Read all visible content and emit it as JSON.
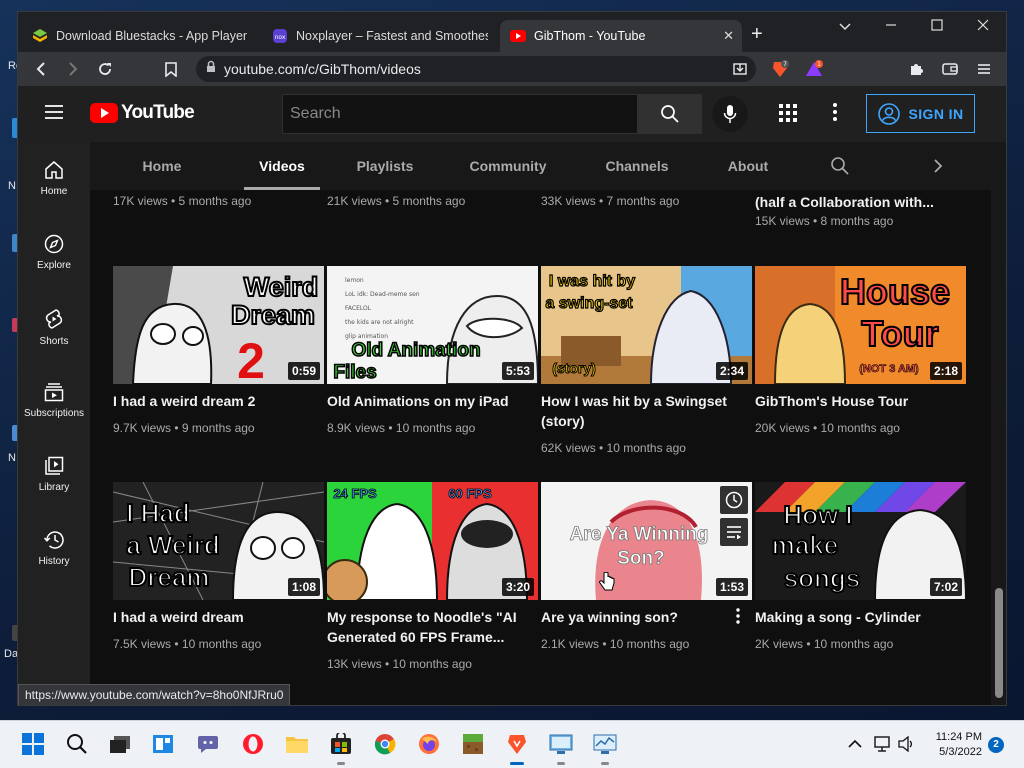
{
  "desktop": {
    "fragments": [
      "Re",
      "N",
      "N",
      "Da"
    ]
  },
  "browser": {
    "tabs": [
      {
        "title": "Download Bluestacks - App Player on",
        "favicon": "bluestacks-icon"
      },
      {
        "title": "Noxplayer – Fastest and Smoothest Ar",
        "favicon": "noxplayer-icon"
      },
      {
        "title": "GibThom - YouTube",
        "favicon": "youtube-icon",
        "active": true
      }
    ],
    "url": "youtube.com/c/GibThom/videos",
    "extension_badges": {
      "brave_shields": "7",
      "brave_rewards": "1"
    },
    "status_url": "https://www.youtube.com/watch?v=8ho0NfJRru0"
  },
  "youtube": {
    "logo_text": "YouTube",
    "search_placeholder": "Search",
    "sign_in_label": "SIGN IN",
    "guide": [
      {
        "label": "Home",
        "icon": "home-icon"
      },
      {
        "label": "Explore",
        "icon": "compass-icon"
      },
      {
        "label": "Shorts",
        "icon": "shorts-icon"
      },
      {
        "label": "Subscriptions",
        "icon": "subscriptions-icon"
      },
      {
        "label": "Library",
        "icon": "library-icon"
      },
      {
        "label": "History",
        "icon": "history-icon"
      }
    ],
    "channel_tabs": [
      "Home",
      "Videos",
      "Playlists",
      "Community",
      "Channels",
      "About"
    ],
    "active_tab": "Videos",
    "top_row_meta": [
      "17K views • 5 months ago",
      "21K views • 5 months ago",
      "33K views • 7 months ago",
      "15K views • 8 months ago"
    ],
    "top_row_partial_title": "(half a Collaboration with...",
    "videos": [
      {
        "title": "I had a weird dream 2",
        "meta": "9.7K views • 9 months ago",
        "duration": "0:59",
        "thumb_text": [
          "Weird",
          "Dream"
        ]
      },
      {
        "title": "Old Animations on my iPad",
        "meta": "8.9K views • 10 months ago",
        "duration": "5:53",
        "thumb_text": [
          "Old Animation",
          "Files"
        ]
      },
      {
        "title": "How I was hit by a Swingset (story)",
        "title_lines": [
          "How I was hit by a Swingset",
          "(story)"
        ],
        "meta": "62K views • 10 months ago",
        "duration": "2:34",
        "thumb_text": [
          "I was hit by",
          "a swing-set",
          "(story)"
        ]
      },
      {
        "title": "GibThom's House Tour",
        "meta": "20K views • 10 months ago",
        "duration": "2:18",
        "thumb_text": [
          "House",
          "Tour",
          "(NOT 3 AM)"
        ]
      },
      {
        "title": "I had a weird dream",
        "meta": "7.5K views • 10 months ago",
        "duration": "1:08",
        "thumb_text": [
          "I Had",
          "a Weird",
          "Dream"
        ]
      },
      {
        "title_lines": [
          "My response to Noodle's \"AI",
          "Generated 60 FPS Frame..."
        ],
        "meta": "13K views • 10 months ago",
        "duration": "3:20",
        "thumb_text": [
          "24 FPS",
          "60 FPS"
        ]
      },
      {
        "title": "Are ya winning son?",
        "meta": "2.1K views • 10 months ago",
        "duration": "1:53",
        "thumb_text": [
          "Are Ya Winning",
          "Son?"
        ]
      },
      {
        "title": "Making a song - Cylinder",
        "meta": "2K views • 10 months ago",
        "duration": "7:02",
        "thumb_text": [
          "How I",
          "make",
          "songs"
        ]
      }
    ]
  },
  "taskbar": {
    "time": "11:24 PM",
    "date": "5/3/2022",
    "notifications": "2"
  }
}
